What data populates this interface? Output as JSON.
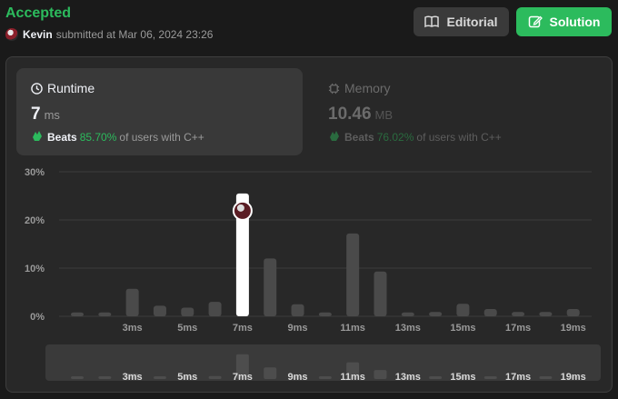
{
  "header": {
    "status": "Accepted",
    "user": "Kevin",
    "submitted_text": "submitted at Mar 06, 2024 23:26"
  },
  "buttons": {
    "editorial": "Editorial",
    "solution": "Solution"
  },
  "runtime": {
    "title": "Runtime",
    "value": "7",
    "unit": "ms",
    "beats_label": "Beats",
    "beats_pct": "85.70%",
    "beats_tail": "of users with C++"
  },
  "memory": {
    "title": "Memory",
    "value": "10.46",
    "unit": "MB",
    "beats_label": "Beats",
    "beats_pct": "76.02%",
    "beats_tail": "of users with C++"
  },
  "colors": {
    "accent": "#2cbb5d",
    "bar": "#4a4a4a",
    "highlight_bar": "#ffffff"
  },
  "chart_data": {
    "type": "bar",
    "x": [
      1,
      2,
      3,
      4,
      5,
      6,
      7,
      8,
      9,
      10,
      11,
      12,
      13,
      14,
      15,
      16,
      17,
      18,
      19
    ],
    "values": [
      0.8,
      0.8,
      5.7,
      2.2,
      1.8,
      3.0,
      25.5,
      12.0,
      2.5,
      0.8,
      17.2,
      9.3,
      0.8,
      0.9,
      2.6,
      1.5,
      0.9,
      0.9,
      1.5
    ],
    "highlight_x": 7,
    "y_ticks": [
      "0%",
      "10%",
      "20%",
      "30%"
    ],
    "x_ticks": [
      "3ms",
      "5ms",
      "7ms",
      "9ms",
      "11ms",
      "13ms",
      "15ms",
      "17ms",
      "19ms"
    ],
    "ylim": [
      0,
      30
    ]
  }
}
